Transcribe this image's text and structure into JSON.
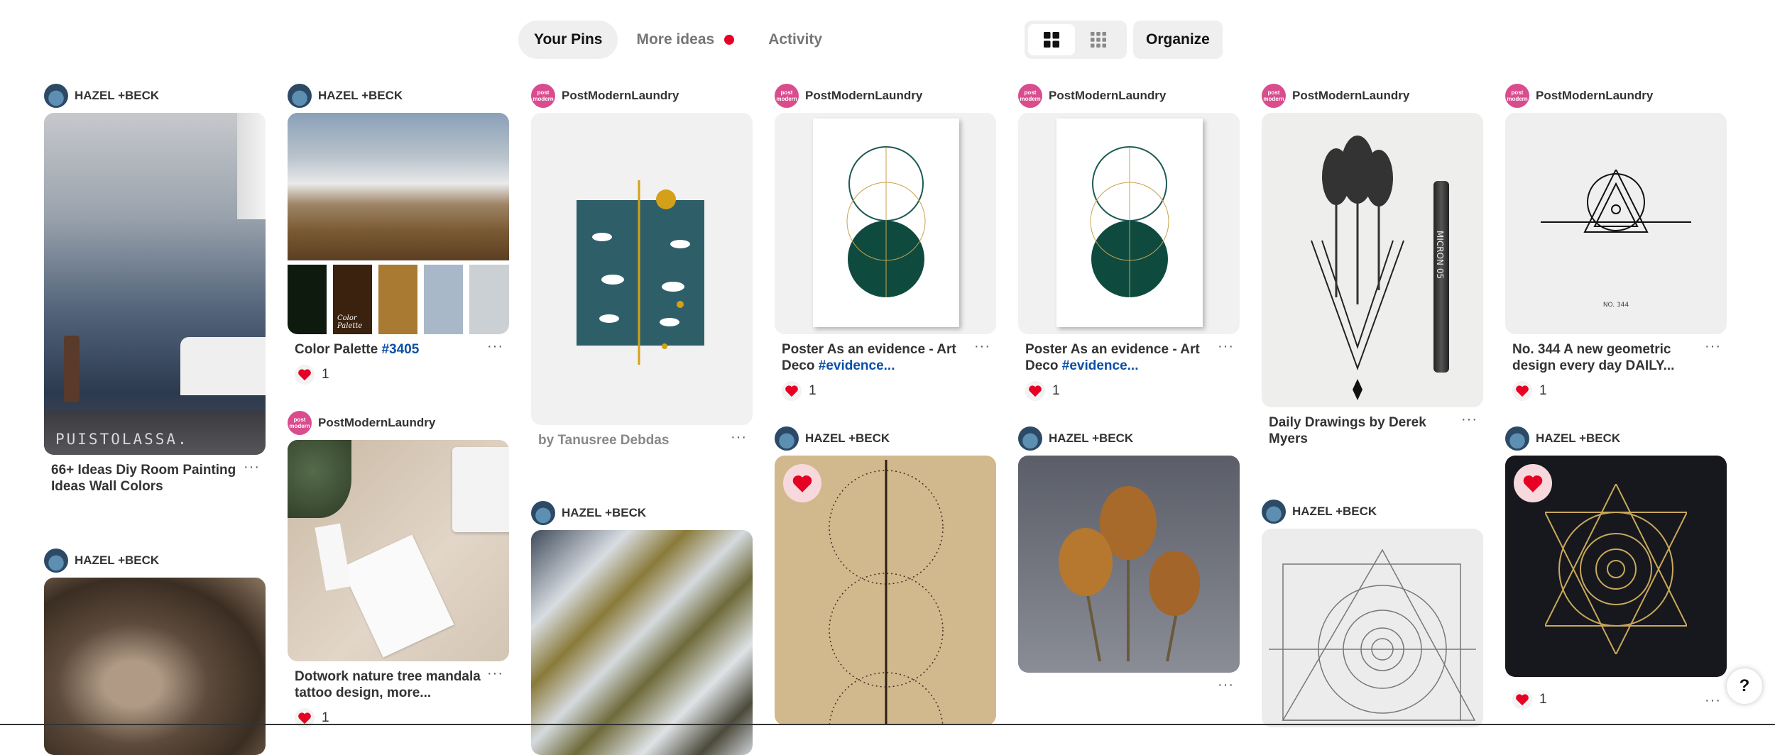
{
  "tabs": [
    {
      "label": "Your Pins",
      "active": true
    },
    {
      "label": "More ideas",
      "active": false,
      "dot": true
    },
    {
      "label": "Activity",
      "active": false
    }
  ],
  "toolbar": {
    "view_default_icon": "grid-large-icon",
    "view_compact_icon": "grid-small-icon",
    "organize_label": "Organize"
  },
  "colors": {
    "accent_red": "#e60023",
    "hashtag_blue": "#0a4fa8"
  },
  "authors": {
    "hazel": "HAZEL +BECK",
    "pml": "PostModernLaundry"
  },
  "pins": {
    "c1a": {
      "title": "66+ Ideas Diy Room Painting Ideas Wall Colors",
      "watermark": "PUISTOLASSA."
    },
    "c2a": {
      "title": "Color Palette ",
      "hash": "#3405",
      "likes": "1",
      "palette_text": "Color Palette"
    },
    "c2b": {
      "title": "Dotwork nature tree mandala tattoo design, more...",
      "likes": "1"
    },
    "c3a": {
      "title": "by Tanusree Debdas"
    },
    "c4a": {
      "title": "Poster As an evidence - Art Deco ",
      "hash": "#evidence...",
      "likes": "1"
    },
    "c5a": {
      "title": "Poster As an evidence - Art Deco ",
      "hash": "#evidence...",
      "likes": "1"
    },
    "c6a": {
      "title": "Daily Drawings by Derek Myers",
      "pen_text": "MICRON 05"
    },
    "c7a": {
      "title": "No. 344 A new geometric design every day DAILY...",
      "likes": "1",
      "caption": "NO. 344"
    },
    "c7b": {
      "likes": "1"
    }
  },
  "help_label": "?"
}
